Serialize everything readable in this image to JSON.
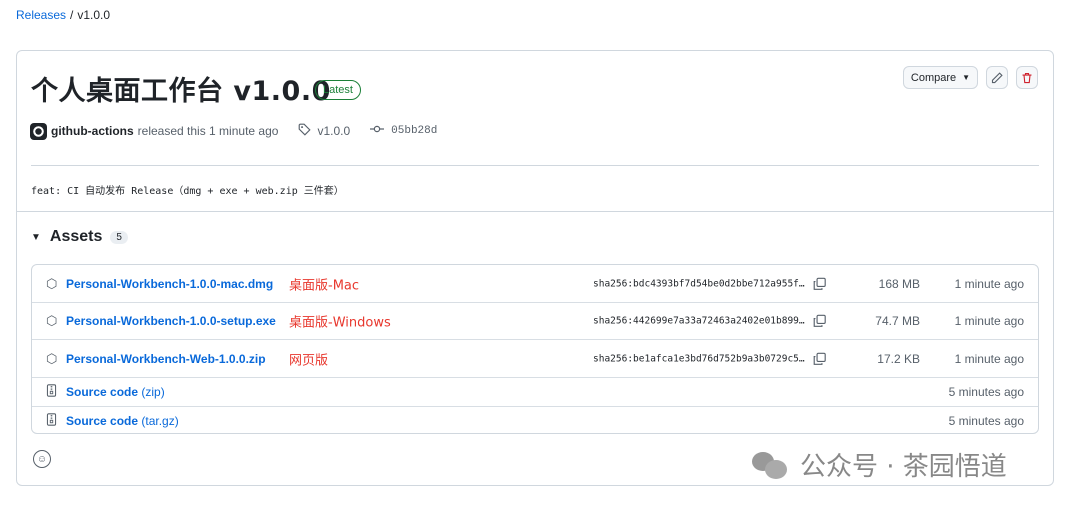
{
  "breadcrumb": {
    "parent": "Releases",
    "separator": "/",
    "current": "v1.0.0"
  },
  "release": {
    "title": "个人桌面工作台 v1.0.0",
    "latest_badge": "Latest",
    "actor": "github-actions",
    "released_text": "released this 1 minute ago",
    "tag": "v1.0.0",
    "commit": "05bb28d",
    "body": "feat: CI 自动发布 Release（dmg + exe + web.zip 三件套）"
  },
  "toolbar": {
    "compare_label": "Compare",
    "edit_icon": "pencil-icon",
    "delete_icon": "trash-icon"
  },
  "assets": {
    "label": "Assets",
    "count": "5",
    "files": [
      {
        "name": "Personal-Workbench-1.0.0-mac.dmg",
        "note": "桌面版-Mac",
        "sha": "sha256:bdc4393bf7d54be0d2bbe712a955f…",
        "size": "168 MB",
        "time": "1 minute ago"
      },
      {
        "name": "Personal-Workbench-1.0.0-setup.exe",
        "note": "桌面版-Windows",
        "sha": "sha256:442699e7a33a72463a2402e01b899…",
        "size": "74.7 MB",
        "time": "1 minute ago"
      },
      {
        "name": "Personal-Workbench-Web-1.0.0.zip",
        "note": "网页版",
        "sha": "sha256:be1afca1e3bd76d752b9a3b0729c5…",
        "size": "17.2 KB",
        "time": "1 minute ago"
      }
    ],
    "sources": [
      {
        "name": "Source code",
        "suffix": "(zip)",
        "time": "5 minutes ago"
      },
      {
        "name": "Source code",
        "suffix": "(tar.gz)",
        "time": "5 minutes ago"
      }
    ]
  },
  "watermark": "公众号 · 茶园悟道",
  "colors": {
    "link": "#0969da",
    "latest": "#1a7f37",
    "danger": "#cf222e",
    "annotation": "#e8372d"
  }
}
